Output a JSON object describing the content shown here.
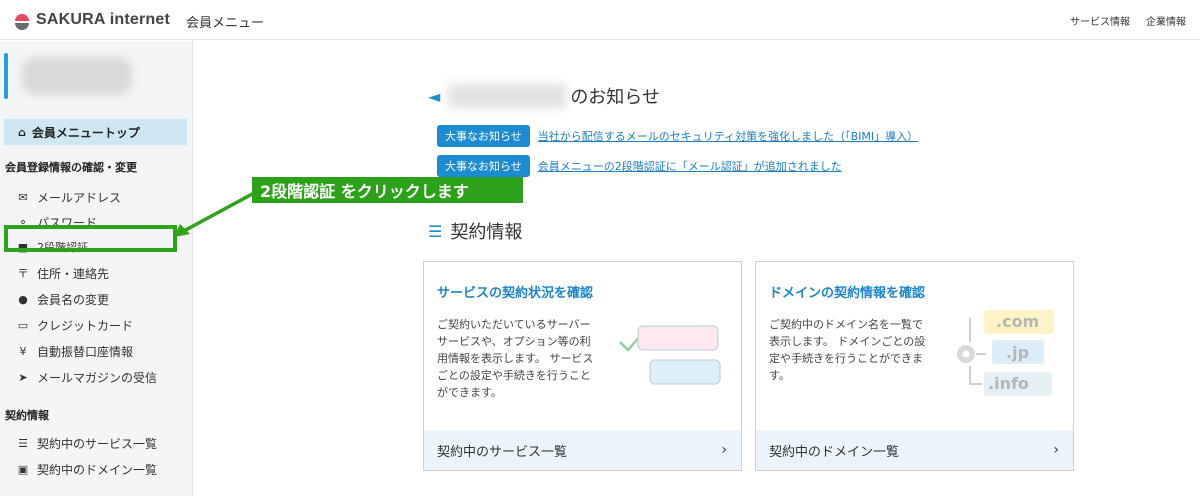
{
  "header": {
    "brand": "SAKURA internet",
    "subtitle": "会員メニュー",
    "links": [
      "サービス情報",
      "企業情報"
    ]
  },
  "sidebar": {
    "top_item": "会員メニュートップ",
    "section1_title": "会員登録情報の確認・変更",
    "section1_items": [
      {
        "label": "メールアドレス",
        "icon": "envelope-icon"
      },
      {
        "label": "パスワード",
        "icon": "key-icon"
      },
      {
        "label": "2段階認証",
        "icon": "lock-icon"
      },
      {
        "label": "住所・連絡先",
        "icon": "postal-icon"
      },
      {
        "label": "会員名の変更",
        "icon": "user-icon"
      },
      {
        "label": "クレジットカード",
        "icon": "credit-card-icon"
      },
      {
        "label": "自動振替口座情報",
        "icon": "yen-icon"
      },
      {
        "label": "メールマガジンの受信",
        "icon": "paper-plane-icon"
      }
    ],
    "section2_title": "契約情報",
    "section2_items": [
      {
        "label": "契約中のサービス一覧",
        "icon": "server-icon"
      },
      {
        "label": "契約中のドメイン一覧",
        "icon": "window-icon"
      }
    ]
  },
  "callout": {
    "text": "2段階認証 をクリックします"
  },
  "main": {
    "news_title_suffix": "のお知らせ",
    "news": [
      {
        "badge": "大事なお知らせ",
        "text": "当社から配信するメールのセキュリティ対策を強化しました（「BIMI」導入）"
      },
      {
        "badge": "大事なお知らせ",
        "text": "会員メニューの2段階認証に「メール認証」が追加されました"
      }
    ],
    "contract_title": "契約情報",
    "cards": [
      {
        "heading": "サービスの契約状況を確認",
        "desc": [
          "ご契約いただいているサーバー",
          "サービスや、オプション等の利",
          "用情報を表示します。 サービス",
          "ごとの設定や手続きを行うこと",
          "ができます。"
        ],
        "footer": "契約中のサービス一覧"
      },
      {
        "heading": "ドメインの契約情報を確認",
        "desc": [
          "ご契約中のドメイン名を一覧で",
          "表示します。 ドメインごとの設",
          "定や手続きを行うことができま",
          "す。"
        ],
        "footer": "契約中のドメイン一覧",
        "domains": [
          ".com",
          ".jp",
          ".info"
        ]
      }
    ]
  },
  "colors": {
    "accent": "#1b8ed1",
    "callout": "#2ea11b",
    "nav_active": "#cfe6f3"
  }
}
